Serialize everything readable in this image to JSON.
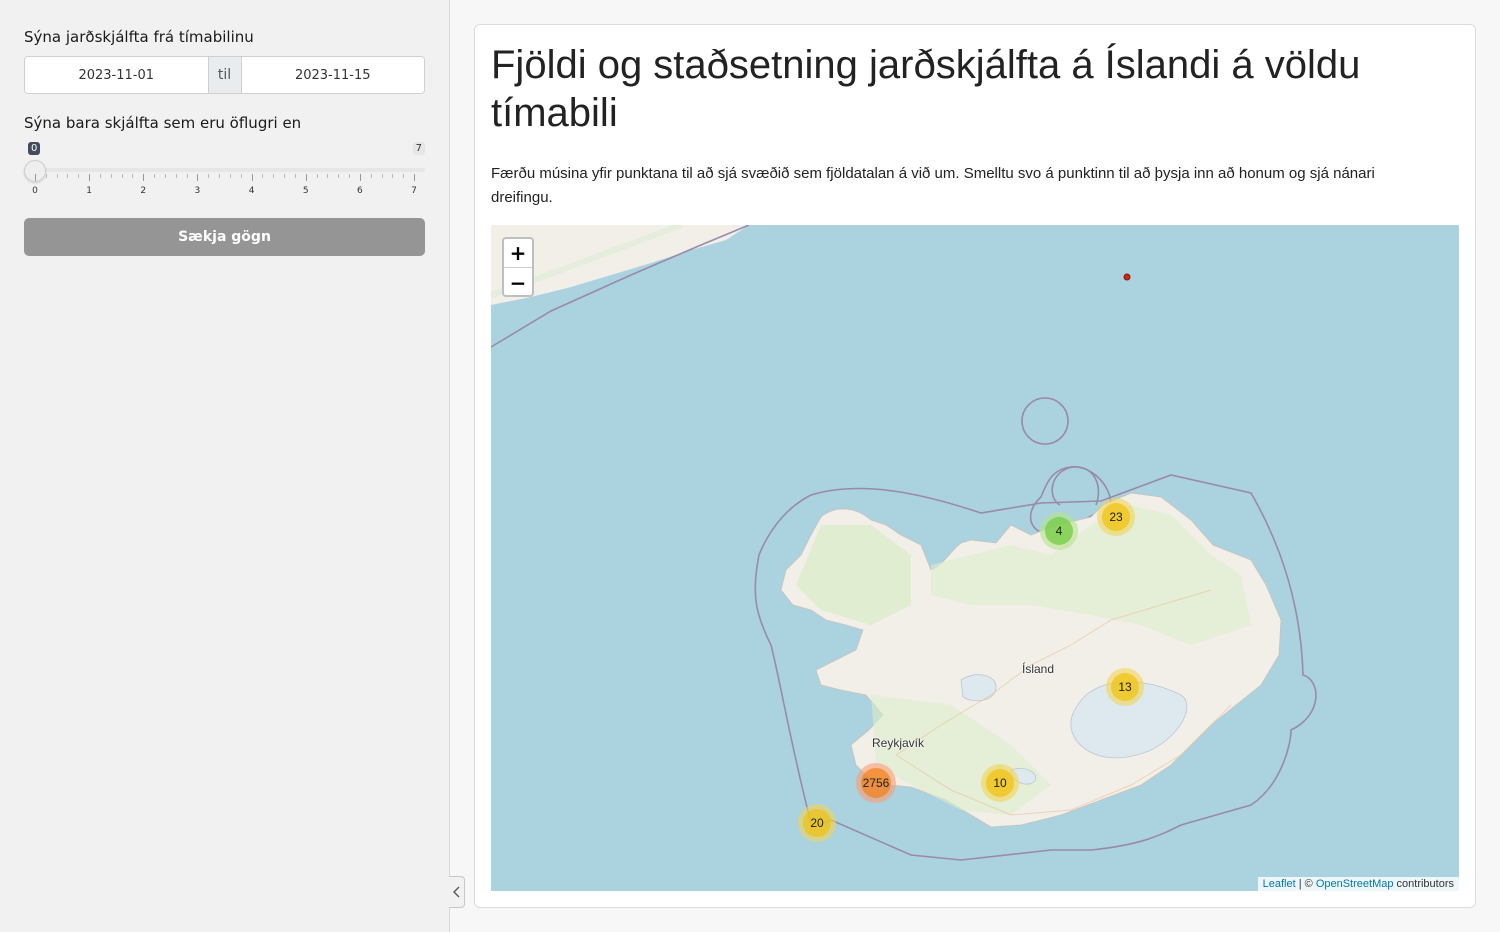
{
  "sidebar": {
    "date_label": "Sýna jarðskjálfta frá tímabilinu",
    "date_start": "2023-11-01",
    "date_separator": "til",
    "date_end": "2023-11-15",
    "magnitude_label": "Sýna bara skjálfta sem eru öflugri en",
    "slider": {
      "value": 0,
      "value_label": "0",
      "min": 0,
      "max": 7,
      "max_label": "7",
      "tick_labels": [
        "0",
        "1",
        "2",
        "3",
        "4",
        "5",
        "6",
        "7"
      ]
    },
    "fetch_button": "Sækja gögn"
  },
  "main": {
    "title": "Fjöldi og staðsetning jarðskjálfta á Íslandi á völdu tímabili",
    "description": "Færðu músina yfir punktana til að sjá svæðið sem fjöldatalan á við um. Smelltu svo á punktinn til að þysja inn að honum og sjá nánari dreifingu."
  },
  "map": {
    "zoom_in": "+",
    "zoom_out": "−",
    "country_label": "Ísland",
    "city_label": "Reykjavík",
    "clusters": {
      "c1": "4",
      "c2": "23",
      "c3": "13",
      "c4": "2756",
      "c5": "10",
      "c6": "20"
    },
    "attribution": {
      "leaflet": "Leaflet",
      "sep": " | © ",
      "osm": "OpenStreetMap",
      "suffix": " contributors"
    },
    "colors": {
      "water": "#aad3df",
      "land": "#f2efe9",
      "green_cluster": "#6ecc39",
      "yellow_cluster": "#f0c20c",
      "orange_cluster": "#f18017"
    }
  }
}
